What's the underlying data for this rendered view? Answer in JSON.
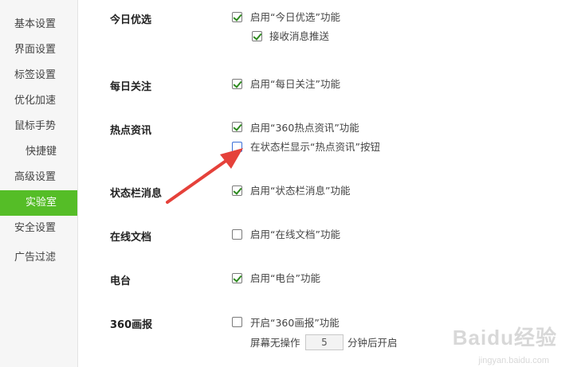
{
  "sidebar": {
    "items": [
      {
        "label": "基本设置",
        "active": false
      },
      {
        "label": "界面设置",
        "active": false
      },
      {
        "label": "标签设置",
        "active": false
      },
      {
        "label": "优化加速",
        "active": false
      },
      {
        "label": "鼠标手势",
        "active": false
      },
      {
        "label": "快捷键",
        "active": false
      },
      {
        "label": "高级设置",
        "active": false
      },
      {
        "label": "实验室",
        "active": true
      },
      {
        "label": "安全设置",
        "active": false
      },
      {
        "label": "广告过滤",
        "active": false
      }
    ]
  },
  "sections": {
    "today_pick": {
      "title": "今日优选",
      "enable": {
        "label": "启用“今日优选”功能",
        "checked": true
      },
      "push": {
        "label": "接收消息推送",
        "checked": true
      }
    },
    "daily_follow": {
      "title": "每日关注",
      "enable": {
        "label": "启用“每日关注”功能",
        "checked": true
      }
    },
    "hot_news": {
      "title": "热点资讯",
      "enable": {
        "label": "启用“360热点资讯”功能",
        "checked": true
      },
      "statusbar_button": {
        "label": "在状态栏显示“热点资讯”按钮",
        "checked": false
      }
    },
    "statusbar_msg": {
      "title": "状态栏消息",
      "enable": {
        "label": "启用“状态栏消息”功能",
        "checked": true
      }
    },
    "online_docs": {
      "title": "在线文档",
      "enable": {
        "label": "启用“在线文档”功能",
        "checked": false
      }
    },
    "radio": {
      "title": "电台",
      "enable": {
        "label": "启用“电台”功能",
        "checked": true
      }
    },
    "pictorial": {
      "title": "360画报",
      "enable": {
        "label": "开启“360画报”功能",
        "checked": false
      },
      "idle_prefix": "屏幕无操作",
      "idle_minutes": "5",
      "idle_suffix": "分钟后开启"
    }
  },
  "annotation": {
    "color": "#e5413a"
  },
  "watermark": {
    "text": "Baidu经验",
    "sub": "jingyan.baidu.com"
  },
  "colors": {
    "accent": "#55bd27",
    "check": "#2d8a1e"
  }
}
